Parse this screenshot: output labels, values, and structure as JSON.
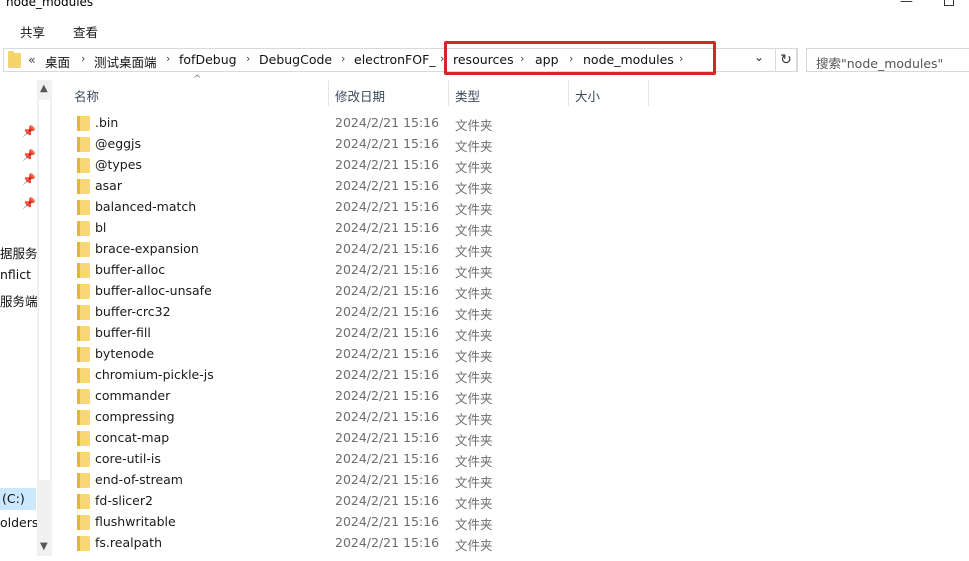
{
  "window": {
    "title": "node_modules",
    "minimize_icon": "minimize-icon",
    "maximize_icon": "maximize-icon"
  },
  "ribbon": {
    "tabs": [
      "共享",
      "查看"
    ]
  },
  "address": {
    "overflow": "«",
    "crumbs": [
      "桌面",
      "测试桌面端",
      "fofDebug",
      "DebugCode",
      "electronFOF_",
      "resources",
      "app",
      "node_modules"
    ],
    "highlight_color": "#d22828",
    "dropdown_icon": "chevron-down-icon",
    "refresh_icon": "refresh-icon"
  },
  "search": {
    "placeholder": "搜索\"node_modules\""
  },
  "nav": {
    "pins": 4,
    "items": [
      "据服务",
      "nflict",
      "服务端",
      "(C:)",
      "olders"
    ]
  },
  "columns": {
    "name": "名称",
    "modified": "修改日期",
    "type": "类型",
    "size": "大小"
  },
  "files": [
    {
      "name": ".bin",
      "modified": "2024/2/21 15:16",
      "type": "文件夹"
    },
    {
      "name": "@eggjs",
      "modified": "2024/2/21 15:16",
      "type": "文件夹"
    },
    {
      "name": "@types",
      "modified": "2024/2/21 15:16",
      "type": "文件夹"
    },
    {
      "name": "asar",
      "modified": "2024/2/21 15:16",
      "type": "文件夹"
    },
    {
      "name": "balanced-match",
      "modified": "2024/2/21 15:16",
      "type": "文件夹"
    },
    {
      "name": "bl",
      "modified": "2024/2/21 15:16",
      "type": "文件夹"
    },
    {
      "name": "brace-expansion",
      "modified": "2024/2/21 15:16",
      "type": "文件夹"
    },
    {
      "name": "buffer-alloc",
      "modified": "2024/2/21 15:16",
      "type": "文件夹"
    },
    {
      "name": "buffer-alloc-unsafe",
      "modified": "2024/2/21 15:16",
      "type": "文件夹"
    },
    {
      "name": "buffer-crc32",
      "modified": "2024/2/21 15:16",
      "type": "文件夹"
    },
    {
      "name": "buffer-fill",
      "modified": "2024/2/21 15:16",
      "type": "文件夹"
    },
    {
      "name": "bytenode",
      "modified": "2024/2/21 15:16",
      "type": "文件夹"
    },
    {
      "name": "chromium-pickle-js",
      "modified": "2024/2/21 15:16",
      "type": "文件夹"
    },
    {
      "name": "commander",
      "modified": "2024/2/21 15:16",
      "type": "文件夹"
    },
    {
      "name": "compressing",
      "modified": "2024/2/21 15:16",
      "type": "文件夹"
    },
    {
      "name": "concat-map",
      "modified": "2024/2/21 15:16",
      "type": "文件夹"
    },
    {
      "name": "core-util-is",
      "modified": "2024/2/21 15:16",
      "type": "文件夹"
    },
    {
      "name": "end-of-stream",
      "modified": "2024/2/21 15:16",
      "type": "文件夹"
    },
    {
      "name": "fd-slicer2",
      "modified": "2024/2/21 15:16",
      "type": "文件夹"
    },
    {
      "name": "flushwritable",
      "modified": "2024/2/21 15:16",
      "type": "文件夹"
    },
    {
      "name": "fs.realpath",
      "modified": "2024/2/21 15:16",
      "type": "文件夹"
    }
  ]
}
